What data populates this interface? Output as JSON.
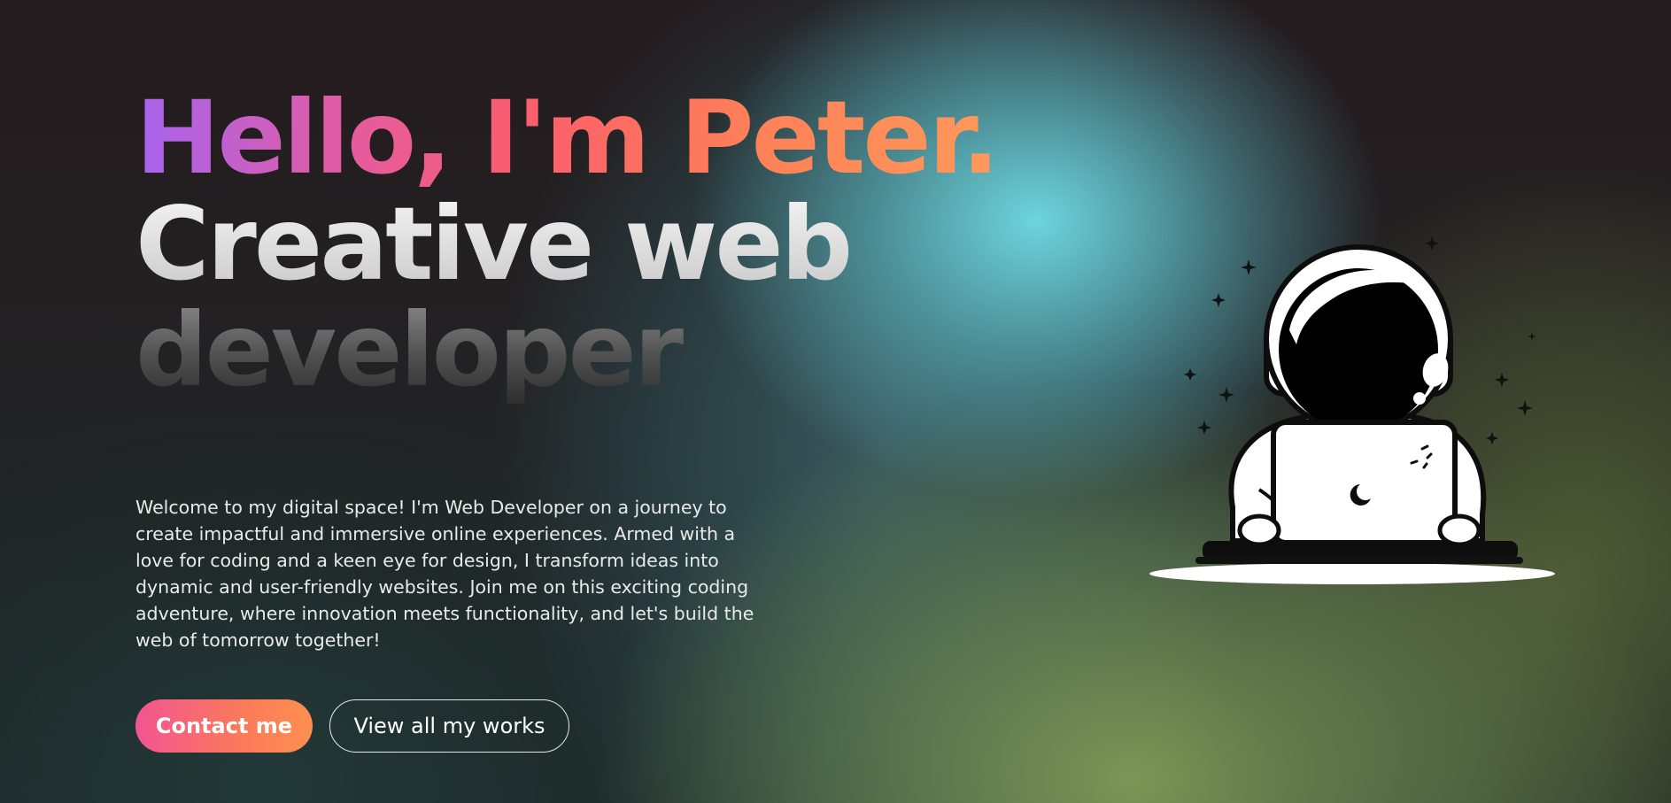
{
  "hero": {
    "greeting_part1": "Hello, I'm",
    "greeting_part2": "Peter.",
    "title_line1": "Creative web",
    "title_line2": "developer",
    "intro": "Welcome to my digital space! I'm Web Developer on a journey to create impactful and immersive online experiences. Armed with a love for coding and a keen eye for design, I transform ideas into dynamic and user-friendly websites. Join me on this exciting coding adventure, where innovation meets functionality, and let's build the web of tomorrow together!"
  },
  "buttons": {
    "contact_label": "Contact me",
    "works_label": "View all my works"
  },
  "illustration": {
    "subject": "astronaut-with-laptop",
    "icons": [
      "star-icon",
      "moon-icon"
    ]
  },
  "colors": {
    "greeting_gradient_start": "#a764f0",
    "greeting_gradient_mid": "#fb5f6a",
    "greeting_gradient_end": "#ff9c5a",
    "primary_button_start": "#f25592",
    "primary_button_end": "#fd8f4f",
    "glow_cyan": "#70dce6",
    "glow_olive": "#87a05a"
  }
}
